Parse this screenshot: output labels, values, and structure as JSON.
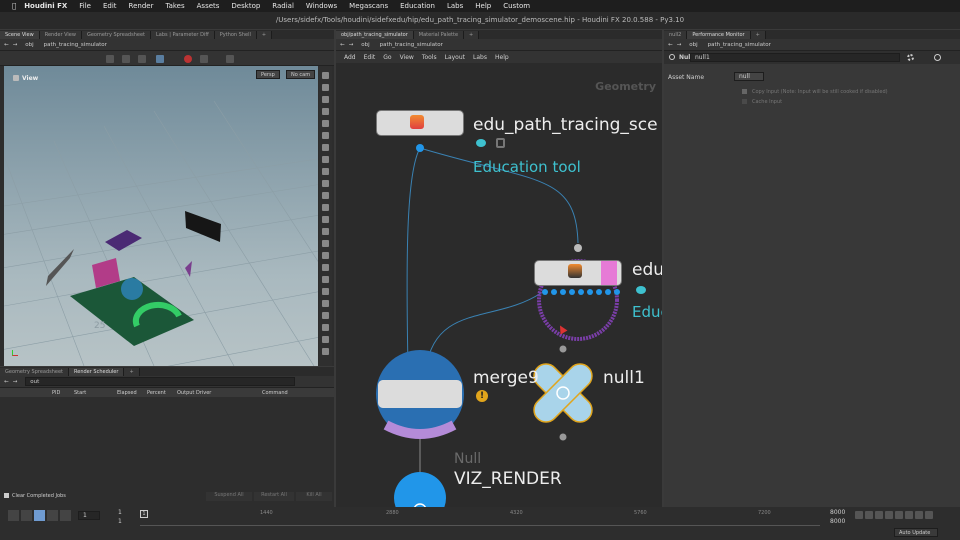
{
  "menubar": {
    "app": "Houdini FX",
    "items": [
      "File",
      "Edit",
      "Render",
      "Takes",
      "Assets",
      "Desktop",
      "Radial",
      "Windows",
      "Megascans",
      "Education",
      "Labs",
      "Help",
      "Custom"
    ]
  },
  "window_title": "/Users/sidefx/Tools/houdini/sidefxedu/hip/edu_path_tracing_simulator_demoscene.hip - Houdini FX 20.0.588 - Py3.10",
  "left_panel": {
    "tabs": [
      "Scene View",
      "Render View",
      "Geometry Spreadsheet",
      "Labs | Parameter Diff",
      "Python Shell"
    ],
    "path": [
      "obj",
      "path_tracing_simulator"
    ],
    "view_label": "View",
    "persp": "Persp",
    "cam": "No cam",
    "grid_label": "25"
  },
  "bottom_left": {
    "tabs": [
      "Geometry Spreadsheet",
      "Render Scheduler"
    ],
    "field": "out",
    "columns": [
      "PID",
      "Start",
      "Elapsed",
      "Percent",
      "Output Driver",
      "Command"
    ],
    "clear_label": "Clear Completed Jobs",
    "buttons": [
      "Suspend All",
      "Restart All",
      "Kill All"
    ]
  },
  "network": {
    "tabs": [
      "obj/path_tracing_simulator",
      "Material Palette"
    ],
    "path": [
      "obj",
      "path_tracing_simulator"
    ],
    "menu": [
      "Add",
      "Edit",
      "Go",
      "View",
      "Tools",
      "Layout",
      "Labs",
      "Help"
    ],
    "context_label": "Geometry",
    "node1": {
      "name": "edu_path_tracing_sce",
      "sub": "Education tool"
    },
    "node2": {
      "name": "edu",
      "sub": "Educ"
    },
    "merge": "merge9",
    "null1": "null1",
    "viz_type": "Null",
    "viz": "VIZ_RENDER"
  },
  "right_panel": {
    "tabs": [
      "null2",
      "Performance Monitor"
    ],
    "path": [
      "obj",
      "path_tracing_simulator"
    ],
    "node_type": "Null",
    "node_name": "null1",
    "asset_label": "Asset Name",
    "asset_value": "null",
    "copy_input": "Copy Input (Note: Input will be still cooked if disabled)",
    "cache_input": "Cache Input"
  },
  "timeline": {
    "frame": "1",
    "start": "1",
    "end": "1",
    "ticks": [
      "1",
      "1440",
      "2880",
      "4320",
      "5760",
      "7200"
    ],
    "range_top": "8000",
    "range_bot": "8000",
    "auto_update": "Auto Update"
  },
  "colors": {
    "teal": "#3ec1cf",
    "blue": "#2196e9",
    "purple": "#7a3ea8"
  }
}
